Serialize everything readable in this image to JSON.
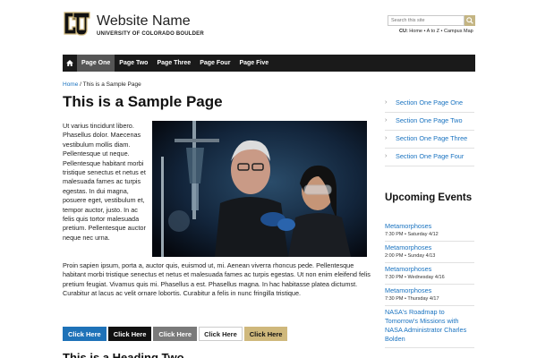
{
  "header": {
    "site_name": "Website Name",
    "university": "UNIVERSITY OF COLORADO BOULDER",
    "search_placeholder": "Search this site",
    "cu_label": "CU:",
    "cu_links": " Home • A to Z • Campus Map"
  },
  "nav": {
    "items": [
      {
        "label": "Page One",
        "active": true
      },
      {
        "label": "Page Two"
      },
      {
        "label": "Page Three"
      },
      {
        "label": "Page Four"
      },
      {
        "label": "Page Five"
      }
    ]
  },
  "breadcrumb": {
    "home": "Home",
    "separator": " / ",
    "current": "This is a Sample Page"
  },
  "main": {
    "title": "This is a Sample Page",
    "wrap_text": "Ut varius tincidunt libero. Phasellus dolor. Maecenas vestibulum mollis diam. Pellentesque ut neque. Pellentesque habitant morbi tristique senectus et netus et malesuada fames ac turpis egestas. In dui magna, posuere eget, vestibulum et, tempor auctor, justo. In ac felis quis tortor malesuada pretium. Pellentesque auctor neque nec urna.",
    "full_text": "Proin sapien ipsum, porta a, auctor quis, euismod ut, mi. Aenean viverra rhoncus pede. Pellentesque habitant morbi tristique senectus et netus et malesuada fames ac turpis egestas. Ut non enim eleifend felis pretium feugiat. Vivamus quis mi. Phasellus a est. Phasellus magna. In hac habitasse platea dictumst. Curabitur at lacus ac velit ornare lobortis. Curabitur a felis in nunc fringilla tristique.",
    "buttons": [
      "Click Here",
      "Click Here",
      "Click Here",
      "Click Here",
      "Click Here"
    ],
    "heading_two": "This is a Heading Two"
  },
  "sidebar": {
    "menu": [
      "Section One Page One",
      "Section One Page Two",
      "Section One Page Three",
      "Section One Page Four"
    ],
    "events_title": "Upcoming Events",
    "events": [
      {
        "title": "Metamorphoses",
        "time": "7:30 PM • Saturday 4/12"
      },
      {
        "title": "Metamorphoses",
        "time": "2:00 PM • Sunday 4/13"
      },
      {
        "title": "Metamorphoses",
        "time": "7:30 PM • Wednesday 4/16"
      },
      {
        "title": "Metamorphoses",
        "time": "7:30 PM • Thursday 4/17"
      },
      {
        "title": "NASA's Roadmap to Tomorrow's Missions with NASA Administrator Charles Bolden",
        "time": ""
      }
    ]
  },
  "colors": {
    "gold": "#cfb87c",
    "nav_bg": "#1a1a1a",
    "nav_active": "#555555",
    "link": "#1a73c0"
  }
}
